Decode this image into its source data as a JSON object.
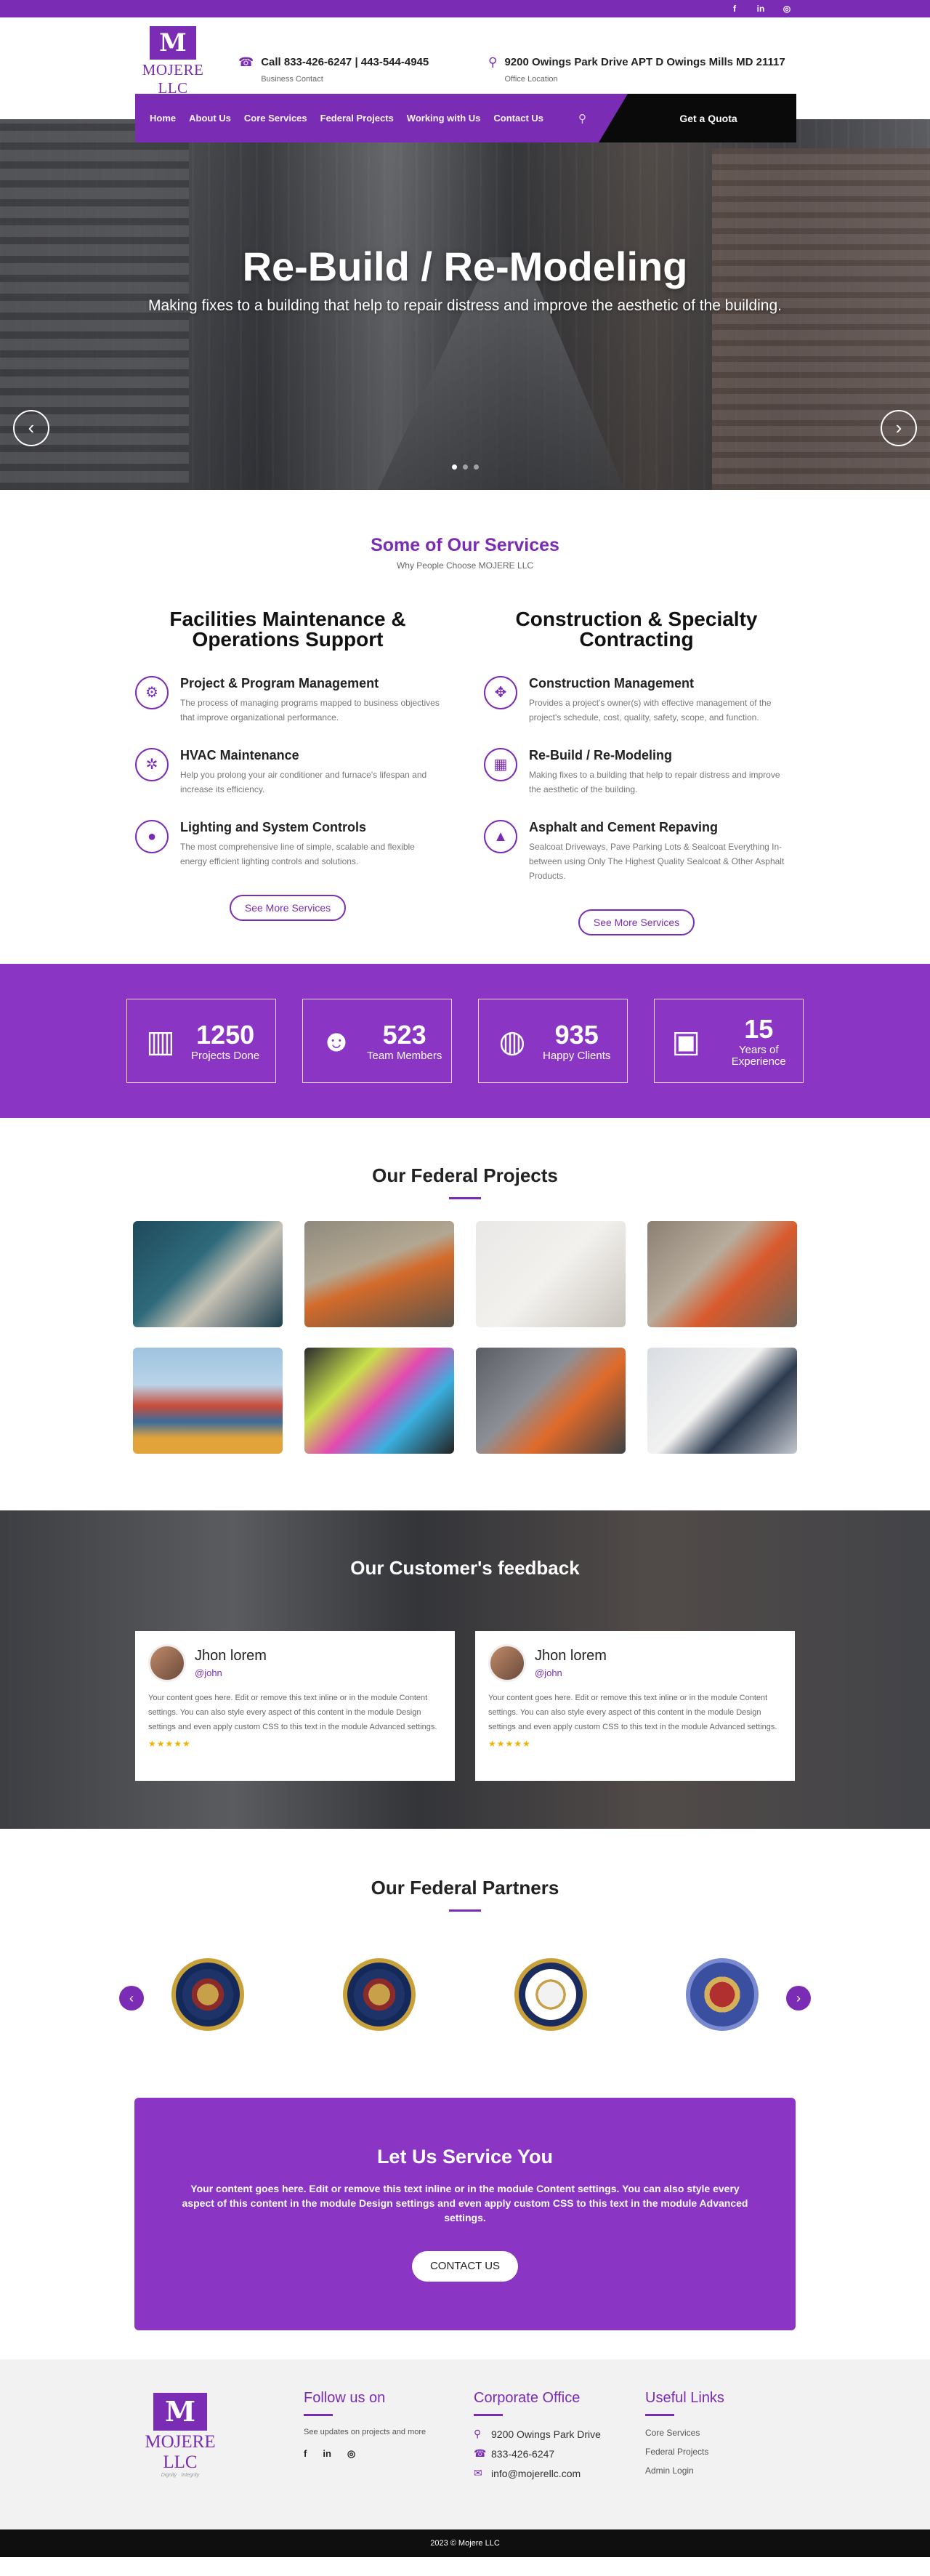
{
  "topbar": {
    "social": [
      "f",
      "in",
      "◎"
    ]
  },
  "logo": {
    "mark": "M",
    "name": "MOJERE LLC",
    "tag": "Dignity · Integrity"
  },
  "contact": {
    "phone": "Call 833-426-6247   |   443-544-4945",
    "phone_label": "Business Contact",
    "address": "9200 Owings Park Drive APT D Owings Mills MD 21117",
    "address_label": "Office Location"
  },
  "nav": {
    "items": [
      "Home",
      "About Us",
      "Core Services",
      "Federal Projects",
      "Working with Us",
      "Contact Us"
    ],
    "cta": "Get a Quota"
  },
  "hero": {
    "title": "Re-Build / Re-Modeling",
    "subtitle": "Making fixes to a building that help to repair distress and improve the aesthetic of the building."
  },
  "services": {
    "title": "Some of Our Services",
    "subtitle": "Why People Choose MOJERE LLC",
    "left": {
      "heading": "Facilities Maintenance & Operations Support",
      "items": [
        {
          "title": "Project & Program Management",
          "text": "The process of managing programs mapped to business objectives that improve organizational performance.",
          "icon": "gears-icon"
        },
        {
          "title": "HVAC Maintenance",
          "text": "Help you prolong your air conditioner and furnace's lifespan and increase its efficiency.",
          "icon": "fan-icon"
        },
        {
          "title": "Lighting and System Controls",
          "text": "The most comprehensive line of simple, scalable and flexible energy efficient lighting controls and solutions.",
          "icon": "bulb-icon"
        }
      ],
      "more": "See More Services"
    },
    "right": {
      "heading": "Construction & Specialty Contracting",
      "items": [
        {
          "title": "Construction Management",
          "text": "Provides a project's owner(s) with effective management of the project's schedule, cost, quality, safety, scope, and function.",
          "icon": "helmet-icon"
        },
        {
          "title": "Re-Build / Re-Modeling",
          "text": "Making fixes to a building that help to repair distress and improve the aesthetic of the building.",
          "icon": "building-icon"
        },
        {
          "title": "Asphalt and Cement Repaving",
          "text": "Sealcoat Driveways, Pave Parking Lots & Sealcoat Everything In-between using Only The Highest Quality Sealcoat & Other Asphalt Products.",
          "icon": "road-icon"
        }
      ],
      "more": "See More Services"
    }
  },
  "stats": [
    {
      "value": "1250",
      "label": "Projects Done",
      "icon": "buildings-icon"
    },
    {
      "value": "523",
      "label": "Team Members",
      "icon": "team-icon"
    },
    {
      "value": "935",
      "label": "Happy Clients",
      "icon": "globe-icon"
    },
    {
      "value": "15",
      "label": "Years of Experience",
      "icon": "briefcase-icon"
    }
  ],
  "projects": {
    "title": "Our Federal Projects"
  },
  "feedback": {
    "title": "Our Customer's feedback",
    "cards": [
      {
        "name": "Jhon lorem",
        "handle": "@john",
        "text": "Your content goes here. Edit or remove this text inline or in the module Content settings. You can also style every aspect of this content in the module Design settings and even apply custom CSS to this text in the module Advanced settings.",
        "stars": "★★★★★"
      },
      {
        "name": "Jhon lorem",
        "handle": "@john",
        "text": "Your content goes here. Edit or remove this text inline or in the module Content settings. You can also style every aspect of this content in the module Design settings and even apply custom CSS to this text in the module Advanced settings.",
        "stars": "★★★★★"
      }
    ]
  },
  "partners": {
    "title": "Our Federal Partners"
  },
  "cta": {
    "title": "Let Us Service You",
    "text": "Your content goes here. Edit or remove this text inline or in the module Content settings. You can also style every aspect of this content in the module Design settings and even apply custom CSS to this text in the module Advanced settings.",
    "button": "CONTACT US"
  },
  "footer": {
    "follow": {
      "title": "Follow us on",
      "text": "See updates on projects and more",
      "social": [
        "f",
        "in",
        "◎"
      ]
    },
    "office": {
      "title": "Corporate Office",
      "address": "9200 Owings Park Drive",
      "phone": "833-426-6247",
      "email": "info@mojerellc.com"
    },
    "links": {
      "title": "Useful Links",
      "items": [
        "Core Services",
        "Federal Projects",
        "Admin Login"
      ]
    },
    "copyright": "2023 © Mojere LLC"
  }
}
